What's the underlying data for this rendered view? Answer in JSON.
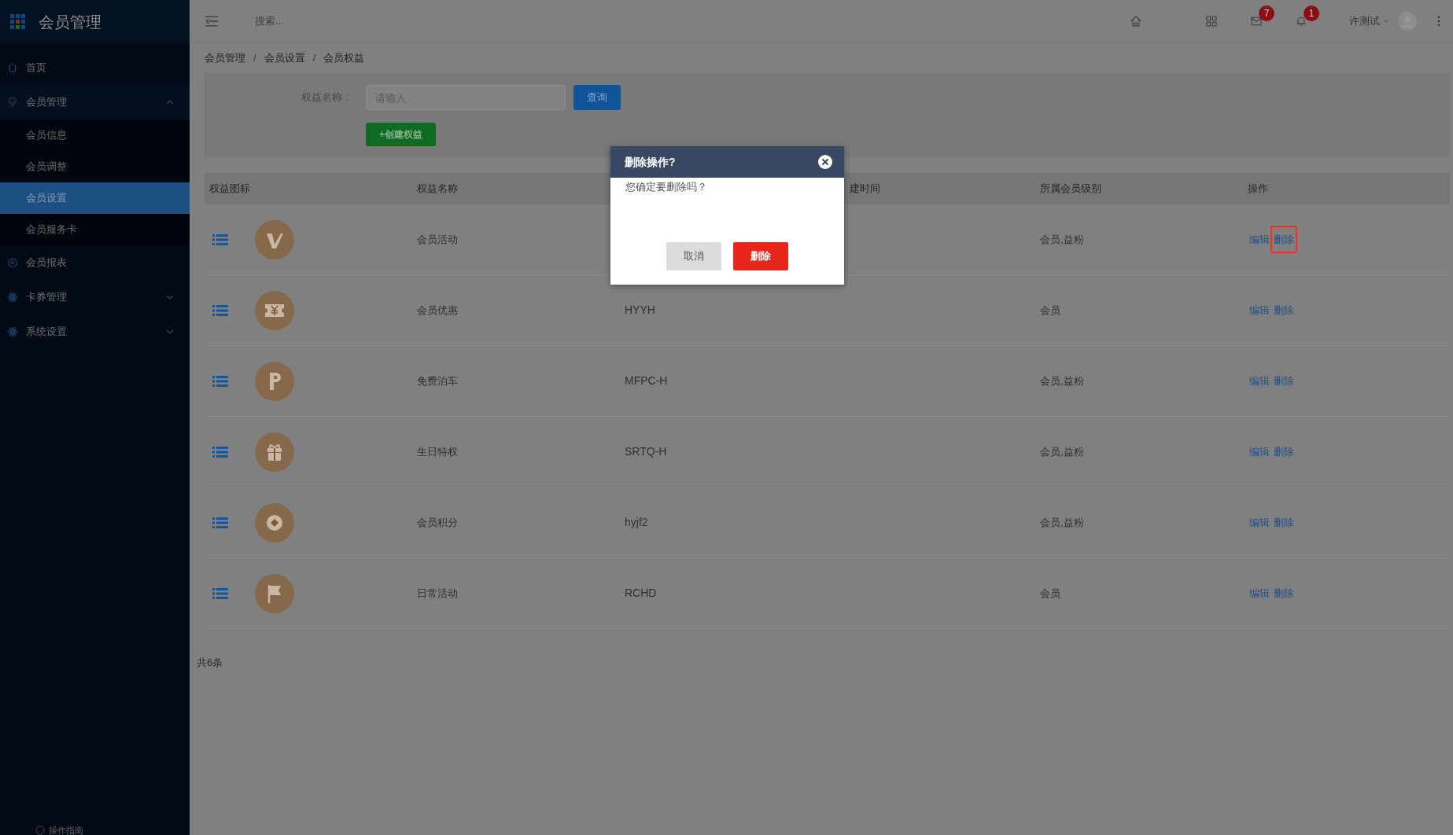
{
  "sidebar": {
    "title": "会员管理",
    "items": [
      {
        "label": "首页",
        "kind": "home"
      },
      {
        "label": "会员管理",
        "kind": "diamond",
        "expanded": true,
        "children": [
          {
            "label": "会员信息",
            "selected": false
          },
          {
            "label": "会员调整",
            "selected": false
          },
          {
            "label": "会员设置",
            "selected": true
          },
          {
            "label": "会员服务卡",
            "selected": false
          }
        ]
      },
      {
        "label": "会员报表",
        "kind": "gear"
      },
      {
        "label": "卡券管理",
        "kind": "atom",
        "expanded": false
      },
      {
        "label": "系统设置",
        "kind": "atom",
        "expanded": false
      }
    ],
    "footer": "操作指南"
  },
  "topbar": {
    "search_placeholder": "搜索...",
    "mail_badge": "7",
    "bell_badge": "1",
    "user": "许测试"
  },
  "breadcrumb": [
    "会员管理",
    "/",
    "会员设置",
    "/",
    "会员权益"
  ],
  "filter": {
    "label": "权益名称：",
    "placeholder": "请输入",
    "query_button": "查询",
    "create_button": "+创建权益"
  },
  "table": {
    "columns": [
      {
        "label": "权益图标"
      },
      {
        "label": "权益名称"
      },
      {},
      {
        "label": "建时间"
      },
      {
        "label": "所属会员级别"
      },
      {
        "label": "操作"
      }
    ],
    "rows": [
      {
        "kind": "check",
        "name": "会员活动",
        "levels": "会员,益粉",
        "actions": [
          {
            "label": "编辑",
            "highlighted": false
          },
          {
            "label": "删除",
            "highlighted": true
          }
        ]
      },
      {
        "kind": "yen",
        "name": "会员优惠",
        "code": "HYYH",
        "levels": "会员",
        "actions": [
          {
            "label": "编辑",
            "highlighted": false
          },
          {
            "label": "删除",
            "highlighted": false
          }
        ]
      },
      {
        "kind": "parking",
        "name": "免费泊车",
        "code": "MFPC-H",
        "levels": "会员,益粉",
        "actions": [
          {
            "label": "编辑",
            "highlighted": false
          },
          {
            "label": "删除",
            "highlighted": false
          }
        ]
      },
      {
        "kind": "gift",
        "name": "生日特权",
        "code": "SRTQ-H",
        "levels": "会员,益粉",
        "actions": [
          {
            "label": "编辑",
            "highlighted": false
          },
          {
            "label": "删除",
            "highlighted": false
          }
        ]
      },
      {
        "kind": "coin",
        "name": "会员积分",
        "code": "hyjf2",
        "levels": "会员,益粉",
        "actions": [
          {
            "label": "编辑",
            "highlighted": false
          },
          {
            "label": "删除",
            "highlighted": false
          }
        ]
      },
      {
        "kind": "flag",
        "name": "日常活动",
        "code": "RCHD",
        "levels": "会员",
        "actions": [
          {
            "label": "编辑",
            "highlighted": false
          },
          {
            "label": "删除",
            "highlighted": false
          }
        ]
      }
    ]
  },
  "total": "共6条",
  "dialog": {
    "title": "删除操作?",
    "message": "您确定要删除吗？",
    "cancel_button": "取消",
    "confirm_button": "删除"
  }
}
